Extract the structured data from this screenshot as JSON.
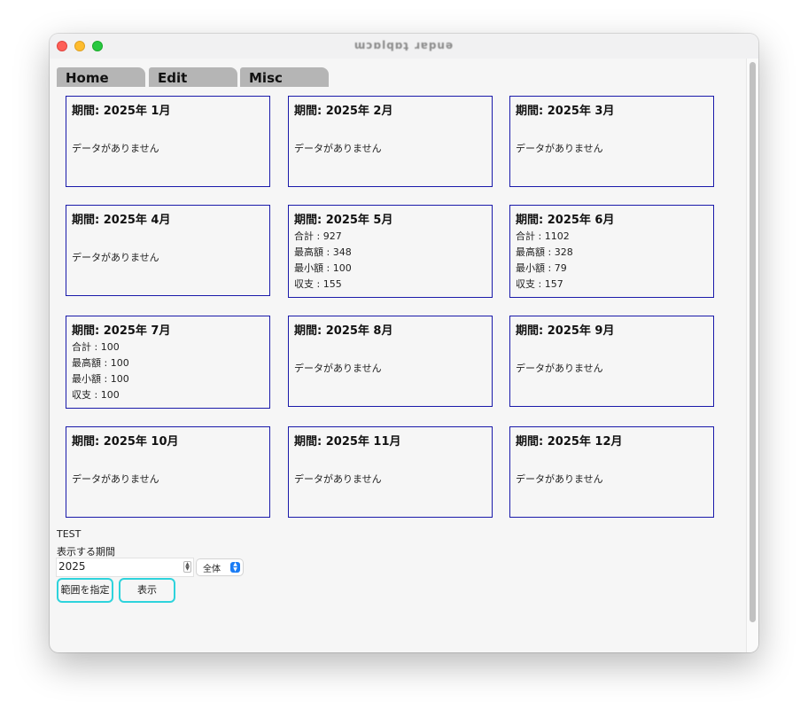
{
  "window": {
    "title": "ɯɔɒlqɒʇ ɹɐpuə"
  },
  "tabs": [
    {
      "label": "Home"
    },
    {
      "label": "Edit"
    },
    {
      "label": "Misc"
    }
  ],
  "cards": [
    {
      "title": "期間: 2025年 1月",
      "empty": "データがありません"
    },
    {
      "title": "期間: 2025年 2月",
      "empty": "データがありません"
    },
    {
      "title": "期間: 2025年 3月",
      "empty": "データがありません"
    },
    {
      "title": "期間: 2025年 4月",
      "empty": "データがありません"
    },
    {
      "title": "期間: 2025年 5月",
      "stats": [
        "合計 : 927",
        "最高額 : 348",
        "最小額 : 100",
        "収支 : 155"
      ]
    },
    {
      "title": "期間: 2025年 6月",
      "stats": [
        "合計 : 1102",
        "最高額 : 328",
        "最小額 : 79",
        "収支 : 157"
      ]
    },
    {
      "title": "期間: 2025年 7月",
      "stats": [
        "合計 : 100",
        "最高額 : 100",
        "最小額 : 100",
        "収支 : 100"
      ]
    },
    {
      "title": "期間: 2025年 8月",
      "empty": "データがありません"
    },
    {
      "title": "期間: 2025年 9月",
      "empty": "データがありません"
    },
    {
      "title": "期間: 2025年 10月",
      "empty": "データがありません"
    },
    {
      "title": "期間: 2025年 11月",
      "empty": "データがありません"
    },
    {
      "title": "期間: 2025年 12月",
      "empty": "データがありません"
    }
  ],
  "footer": {
    "test_label": "TEST",
    "period_label": "表示する期間",
    "year_value": "2025",
    "scope_selected": "全体",
    "range_button": "範囲を指定",
    "show_button": "表示"
  },
  "icons": {
    "stepper": "up-down-stepper-icon",
    "select": "chevron-up-down-icon"
  },
  "colors": {
    "card_border": "#1a1aaa",
    "button_border": "#2ed3dc",
    "select_accent": "#1a7cf5",
    "tab_bg": "#b5b5b5"
  }
}
